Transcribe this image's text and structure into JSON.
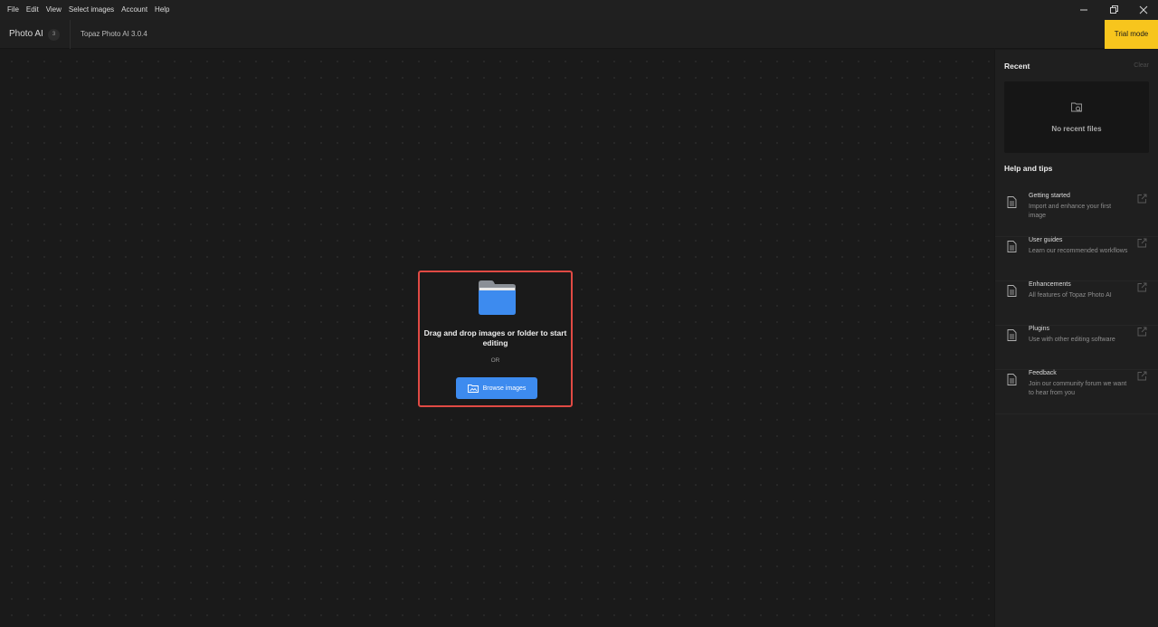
{
  "menubar": {
    "items": [
      "File",
      "Edit",
      "View",
      "Select images",
      "Account",
      "Help"
    ]
  },
  "window_controls": {
    "icons": [
      "minimize-icon",
      "restore-icon",
      "close-icon"
    ]
  },
  "header": {
    "app_name": "Photo AI",
    "badge_count": "3",
    "version": "Topaz Photo AI 3.0.4",
    "trial_label": "Trial mode",
    "trial_color": "#f7c51d"
  },
  "dropzone": {
    "icon": "folder-icon",
    "text": "Drag and drop images or folder to start editing",
    "or_label": "OR",
    "browse_label": "Browse images",
    "browse_icon": "image-folder-icon",
    "accent_color": "#3d8bef",
    "highlight_border": "#e04a44"
  },
  "sidebar": {
    "recent_title": "Recent",
    "clear_label": "Clear",
    "recent_empty": "No recent files",
    "recent_icon": "folder-search-icon",
    "help_title": "Help and tips",
    "tips": [
      {
        "title": "Getting started",
        "desc": "Import and enhance your first image"
      },
      {
        "title": "User guides",
        "desc": "Learn our recommended workflows"
      },
      {
        "title": "Enhancements",
        "desc": "All features of Topaz Photo AI"
      },
      {
        "title": "Plugins",
        "desc": "Use with other editing software"
      },
      {
        "title": "Feedback",
        "desc": "Join our community forum we want to hear from you"
      }
    ]
  }
}
